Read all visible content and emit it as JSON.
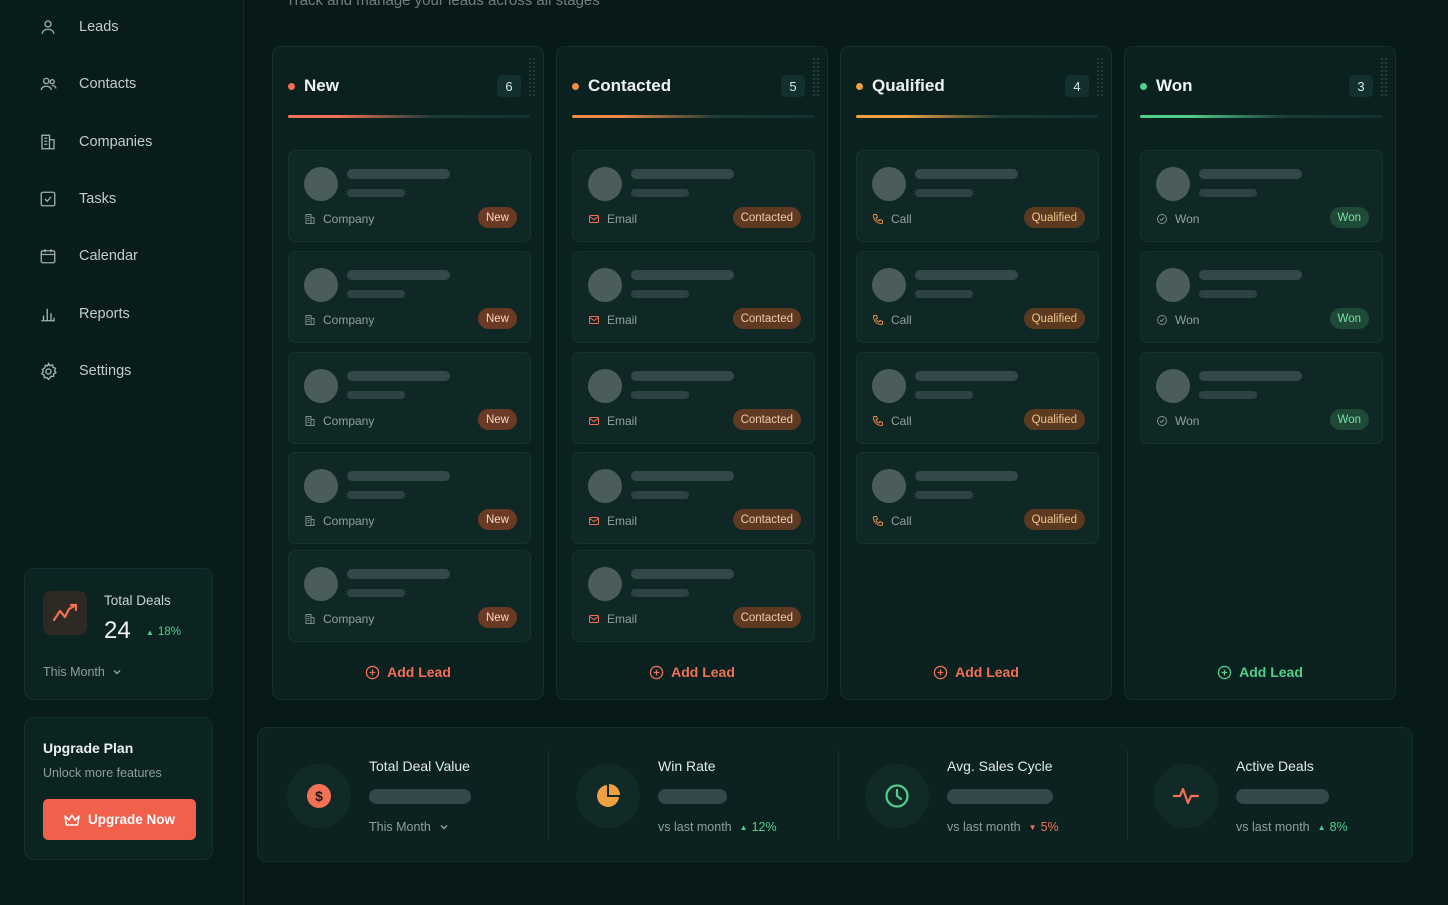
{
  "header": {
    "subtitle": "Track and manage your leads across all stages"
  },
  "sidebar": {
    "items": [
      {
        "label": "Leads",
        "icon": "user-icon"
      },
      {
        "label": "Contacts",
        "icon": "users-icon"
      },
      {
        "label": "Companies",
        "icon": "building-icon"
      },
      {
        "label": "Tasks",
        "icon": "checkbox-icon"
      },
      {
        "label": "Calendar",
        "icon": "calendar-icon"
      },
      {
        "label": "Reports",
        "icon": "bar-chart-icon"
      },
      {
        "label": "Settings",
        "icon": "gear-icon"
      }
    ],
    "total_deals": {
      "title": "Total Deals",
      "value": "24",
      "change": "18%",
      "period": "This Month"
    },
    "upgrade": {
      "title": "Upgrade Plan",
      "subtitle": "Unlock more features",
      "button": "Upgrade Now"
    }
  },
  "columns": [
    {
      "title": "New",
      "count": "6",
      "accent": "#f27155",
      "card_meta": "Company",
      "badge": "New",
      "add_label": "Add Lead"
    },
    {
      "title": "Contacted",
      "count": "5",
      "accent": "#f08a45",
      "card_meta": "Email",
      "badge": "Contacted",
      "add_label": "Add Lead"
    },
    {
      "title": "Qualified",
      "count": "4",
      "accent": "#f0a040",
      "card_meta": "Call",
      "badge": "Qualified",
      "add_label": "Add Lead"
    },
    {
      "title": "Won",
      "count": "3",
      "accent": "#4fd08b",
      "card_meta": "Won",
      "badge": "Won",
      "add_label": "Add Lead"
    }
  ],
  "stats": [
    {
      "title": "Total Deal Value",
      "foot": "This Month",
      "change": "",
      "icon": "dollar-icon"
    },
    {
      "title": "Win Rate",
      "foot": "vs last month",
      "change": "12%",
      "direction": "up",
      "icon": "pie-chart-icon"
    },
    {
      "title": "Avg. Sales Cycle",
      "foot": "vs last month",
      "change": "5%",
      "direction": "down",
      "icon": "clock-icon"
    },
    {
      "title": "Active Deals",
      "foot": "vs last month",
      "change": "8%",
      "direction": "up",
      "icon": "activity-icon"
    }
  ]
}
